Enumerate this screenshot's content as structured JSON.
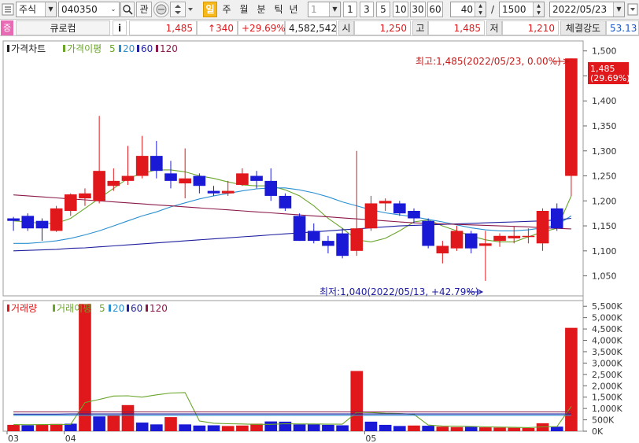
{
  "toolbar": {
    "market": "주식",
    "code": "040350",
    "btn_interest": "관",
    "period_active": "일",
    "periods": [
      "주",
      "월",
      "분",
      "틱",
      "년"
    ],
    "multiplier": "1",
    "quick_counts": [
      "1",
      "3",
      "5",
      "10",
      "30",
      "60"
    ],
    "view_count": "40",
    "separator": "/",
    "total_count": "1500",
    "date": "2022/05/23"
  },
  "info": {
    "badge": "증",
    "name": "큐로컴",
    "info_btn": "i",
    "price": "1,485",
    "change": "↑340",
    "change_pct": "+29.69%",
    "volume": "4,582,542",
    "open_label": "시",
    "open": "1,250",
    "high_label": "고",
    "high": "1,485",
    "low_label": "저",
    "low": "1,210",
    "strength_label": "체결강도",
    "strength": "53.13"
  },
  "price_legend": {
    "title": "가격차트",
    "ma_label": "가격이평",
    "ma_periods": [
      "5",
      "20",
      "60",
      "120"
    ]
  },
  "volume_legend": {
    "title": "거래량",
    "ma_label": "거래이평",
    "ma_periods": [
      "5",
      "20",
      "60",
      "120"
    ]
  },
  "annotations": {
    "high": "최고:1,485(2022/05/23, 0.00%)",
    "low": "최저:1,040(2022/05/13, +42.79%)",
    "last_price": "1,485",
    "last_pct": "(29.69%)"
  },
  "colors": {
    "up": "#e0181b",
    "down": "#1a1ad6",
    "ma5": "#6aa52a",
    "ma20": "#2a8fd0",
    "ma60": "#1f1f9f",
    "ma120": "#8b1a4a"
  },
  "chart_data": [
    {
      "type": "candlestick",
      "title": "가격차트",
      "y_ticks": [
        1050,
        1100,
        1150,
        1200,
        1250,
        1300,
        1350,
        1400,
        1450,
        1500
      ],
      "ylim": [
        1010,
        1520
      ],
      "x_tick_labels": [
        {
          "index": 0,
          "label": "03"
        },
        {
          "index": 4,
          "label": "04"
        },
        {
          "index": 25,
          "label": "05"
        }
      ],
      "candles": [
        {
          "o": 1165,
          "h": 1168,
          "l": 1140,
          "c": 1160
        },
        {
          "o": 1170,
          "h": 1175,
          "l": 1140,
          "c": 1145
        },
        {
          "o": 1160,
          "h": 1165,
          "l": 1120,
          "c": 1145
        },
        {
          "o": 1140,
          "h": 1190,
          "l": 1138,
          "c": 1185
        },
        {
          "o": 1180,
          "h": 1215,
          "l": 1170,
          "c": 1213
        },
        {
          "o": 1205,
          "h": 1225,
          "l": 1190,
          "c": 1215
        },
        {
          "o": 1200,
          "h": 1370,
          "l": 1195,
          "c": 1260
        },
        {
          "o": 1230,
          "h": 1265,
          "l": 1220,
          "c": 1240
        },
        {
          "o": 1240,
          "h": 1310,
          "l": 1232,
          "c": 1250
        },
        {
          "o": 1250,
          "h": 1330,
          "l": 1245,
          "c": 1290
        },
        {
          "o": 1290,
          "h": 1320,
          "l": 1245,
          "c": 1260
        },
        {
          "o": 1255,
          "h": 1280,
          "l": 1225,
          "c": 1240
        },
        {
          "o": 1235,
          "h": 1305,
          "l": 1205,
          "c": 1245
        },
        {
          "o": 1250,
          "h": 1255,
          "l": 1215,
          "c": 1230
        },
        {
          "o": 1220,
          "h": 1230,
          "l": 1210,
          "c": 1215
        },
        {
          "o": 1215,
          "h": 1240,
          "l": 1210,
          "c": 1220
        },
        {
          "o": 1232,
          "h": 1265,
          "l": 1230,
          "c": 1255
        },
        {
          "o": 1250,
          "h": 1260,
          "l": 1225,
          "c": 1240
        },
        {
          "o": 1240,
          "h": 1265,
          "l": 1200,
          "c": 1210
        },
        {
          "o": 1210,
          "h": 1215,
          "l": 1180,
          "c": 1185
        },
        {
          "o": 1170,
          "h": 1175,
          "l": 1120,
          "c": 1120
        },
        {
          "o": 1140,
          "h": 1155,
          "l": 1115,
          "c": 1120
        },
        {
          "o": 1120,
          "h": 1130,
          "l": 1095,
          "c": 1110
        },
        {
          "o": 1135,
          "h": 1145,
          "l": 1085,
          "c": 1090
        },
        {
          "o": 1100,
          "h": 1300,
          "l": 1090,
          "c": 1145
        },
        {
          "o": 1145,
          "h": 1210,
          "l": 1140,
          "c": 1195
        },
        {
          "o": 1195,
          "h": 1205,
          "l": 1180,
          "c": 1200
        },
        {
          "o": 1195,
          "h": 1200,
          "l": 1170,
          "c": 1175
        },
        {
          "o": 1180,
          "h": 1185,
          "l": 1155,
          "c": 1165
        },
        {
          "o": 1160,
          "h": 1165,
          "l": 1105,
          "c": 1110
        },
        {
          "o": 1095,
          "h": 1120,
          "l": 1075,
          "c": 1110
        },
        {
          "o": 1105,
          "h": 1150,
          "l": 1100,
          "c": 1140
        },
        {
          "o": 1135,
          "h": 1140,
          "l": 1095,
          "c": 1105
        },
        {
          "o": 1110,
          "h": 1140,
          "l": 1040,
          "c": 1115
        },
        {
          "o": 1120,
          "h": 1135,
          "l": 1108,
          "c": 1130
        },
        {
          "o": 1125,
          "h": 1150,
          "l": 1115,
          "c": 1130
        },
        {
          "o": 1130,
          "h": 1145,
          "l": 1115,
          "c": 1130
        },
        {
          "o": 1115,
          "h": 1185,
          "l": 1100,
          "c": 1180
        },
        {
          "o": 1185,
          "h": 1195,
          "l": 1140,
          "c": 1145
        },
        {
          "o": 1250,
          "h": 1485,
          "l": 1210,
          "c": 1485
        }
      ],
      "moving_averages": [
        {
          "name": "5",
          "values": [
            1160,
            1158,
            1155,
            1155,
            1165,
            1185,
            1205,
            1225,
            1245,
            1255,
            1262,
            1262,
            1258,
            1250,
            1245,
            1238,
            1232,
            1230,
            1230,
            1222,
            1210,
            1190,
            1165,
            1145,
            1122,
            1118,
            1125,
            1140,
            1158,
            1162,
            1150,
            1140,
            1130,
            1122,
            1118,
            1118,
            1128,
            1138,
            1145,
            1210
          ]
        },
        {
          "name": "20",
          "values": [
            1115,
            1115,
            1117,
            1120,
            1125,
            1132,
            1140,
            1150,
            1160,
            1170,
            1178,
            1188,
            1196,
            1204,
            1210,
            1215,
            1220,
            1224,
            1226,
            1226,
            1222,
            1216,
            1208,
            1198,
            1190,
            1182,
            1176,
            1172,
            1168,
            1163,
            1158,
            1152,
            1146,
            1142,
            1140,
            1140,
            1142,
            1146,
            1152,
            1170
          ]
        },
        {
          "name": "60",
          "values": [
            1100,
            1101,
            1102,
            1103,
            1105,
            1106,
            1108,
            1110,
            1112,
            1114,
            1116,
            1118,
            1120,
            1122,
            1124,
            1126,
            1128,
            1130,
            1132,
            1134,
            1136,
            1138,
            1140,
            1142,
            1144,
            1146,
            1148,
            1150,
            1151,
            1152,
            1153,
            1154,
            1155,
            1156,
            1157,
            1158,
            1159,
            1160,
            1162,
            1165
          ]
        },
        {
          "name": "120",
          "values": [
            1212,
            1210,
            1208,
            1206,
            1204,
            1202,
            1200,
            1198,
            1196,
            1194,
            1192,
            1190,
            1188,
            1186,
            1184,
            1182,
            1180,
            1178,
            1176,
            1174,
            1172,
            1170,
            1168,
            1166,
            1164,
            1162,
            1160,
            1158,
            1156,
            1155,
            1154,
            1153,
            1152,
            1151,
            1150,
            1149,
            1148,
            1146,
            1145,
            1144
          ]
        }
      ]
    },
    {
      "type": "bar",
      "title": "거래량",
      "y_tick_labels": [
        "0K",
        "500K",
        "1,000K",
        "1,500K",
        "2,000K",
        "2,500K",
        "3,000K",
        "3,500K",
        "4,000K",
        "4,500K",
        "5,000K",
        "5,500K"
      ],
      "y_ticks": [
        0,
        500,
        1000,
        1500,
        2000,
        2500,
        3000,
        3500,
        4000,
        4500,
        5000,
        5500
      ],
      "ylim": [
        0,
        5750
      ],
      "unit": "K",
      "values": [
        280,
        260,
        300,
        320,
        330,
        5600,
        650,
        700,
        1150,
        380,
        300,
        620,
        300,
        250,
        260,
        230,
        250,
        330,
        430,
        420,
        300,
        300,
        280,
        260,
        2650,
        420,
        280,
        230,
        250,
        240,
        200,
        180,
        190,
        170,
        160,
        150,
        140,
        350,
        200,
        4550
      ],
      "up_flags": [
        1,
        0,
        1,
        1,
        0,
        1,
        0,
        1,
        1,
        0,
        0,
        1,
        0,
        0,
        0,
        1,
        1,
        1,
        0,
        0,
        0,
        0,
        0,
        0,
        1,
        0,
        0,
        0,
        1,
        0,
        1,
        1,
        0,
        1,
        1,
        1,
        1,
        1,
        0,
        1
      ],
      "moving_averages": [
        {
          "name": "5",
          "values": [
            290,
            285,
            290,
            295,
            300,
            1260,
            1400,
            1550,
            1560,
            1500,
            1600,
            1680,
            1700,
            450,
            350,
            330,
            320,
            300,
            300,
            330,
            320,
            320,
            310,
            310,
            830,
            820,
            790,
            780,
            740,
            270,
            230,
            220,
            210,
            190,
            180,
            170,
            160,
            190,
            200,
            1090
          ]
        },
        {
          "name": "20",
          "values": [
            700,
            700,
            700,
            700,
            700,
            700,
            700,
            700,
            700,
            700,
            700,
            700,
            700,
            700,
            700,
            700,
            700,
            700,
            700,
            700,
            700,
            700,
            700,
            700,
            700,
            700,
            700,
            700,
            700,
            700,
            700,
            700,
            700,
            700,
            700,
            700,
            700,
            700,
            700,
            700
          ]
        },
        {
          "name": "60",
          "values": [
            750,
            750,
            750,
            750,
            760,
            760,
            760,
            760,
            760,
            760,
            760,
            760,
            760,
            760,
            760,
            760,
            760,
            760,
            760,
            760,
            760,
            760,
            760,
            760,
            760,
            760,
            760,
            760,
            760,
            760,
            760,
            760,
            760,
            760,
            760,
            760,
            760,
            760,
            760,
            760
          ]
        },
        {
          "name": "120",
          "values": [
            850,
            850,
            850,
            850,
            850,
            850,
            850,
            850,
            850,
            850,
            850,
            850,
            850,
            850,
            850,
            850,
            850,
            850,
            850,
            850,
            850,
            850,
            850,
            850,
            850,
            850,
            850,
            850,
            850,
            850,
            850,
            850,
            850,
            850,
            850,
            850,
            850,
            850,
            850,
            850
          ]
        }
      ]
    }
  ]
}
